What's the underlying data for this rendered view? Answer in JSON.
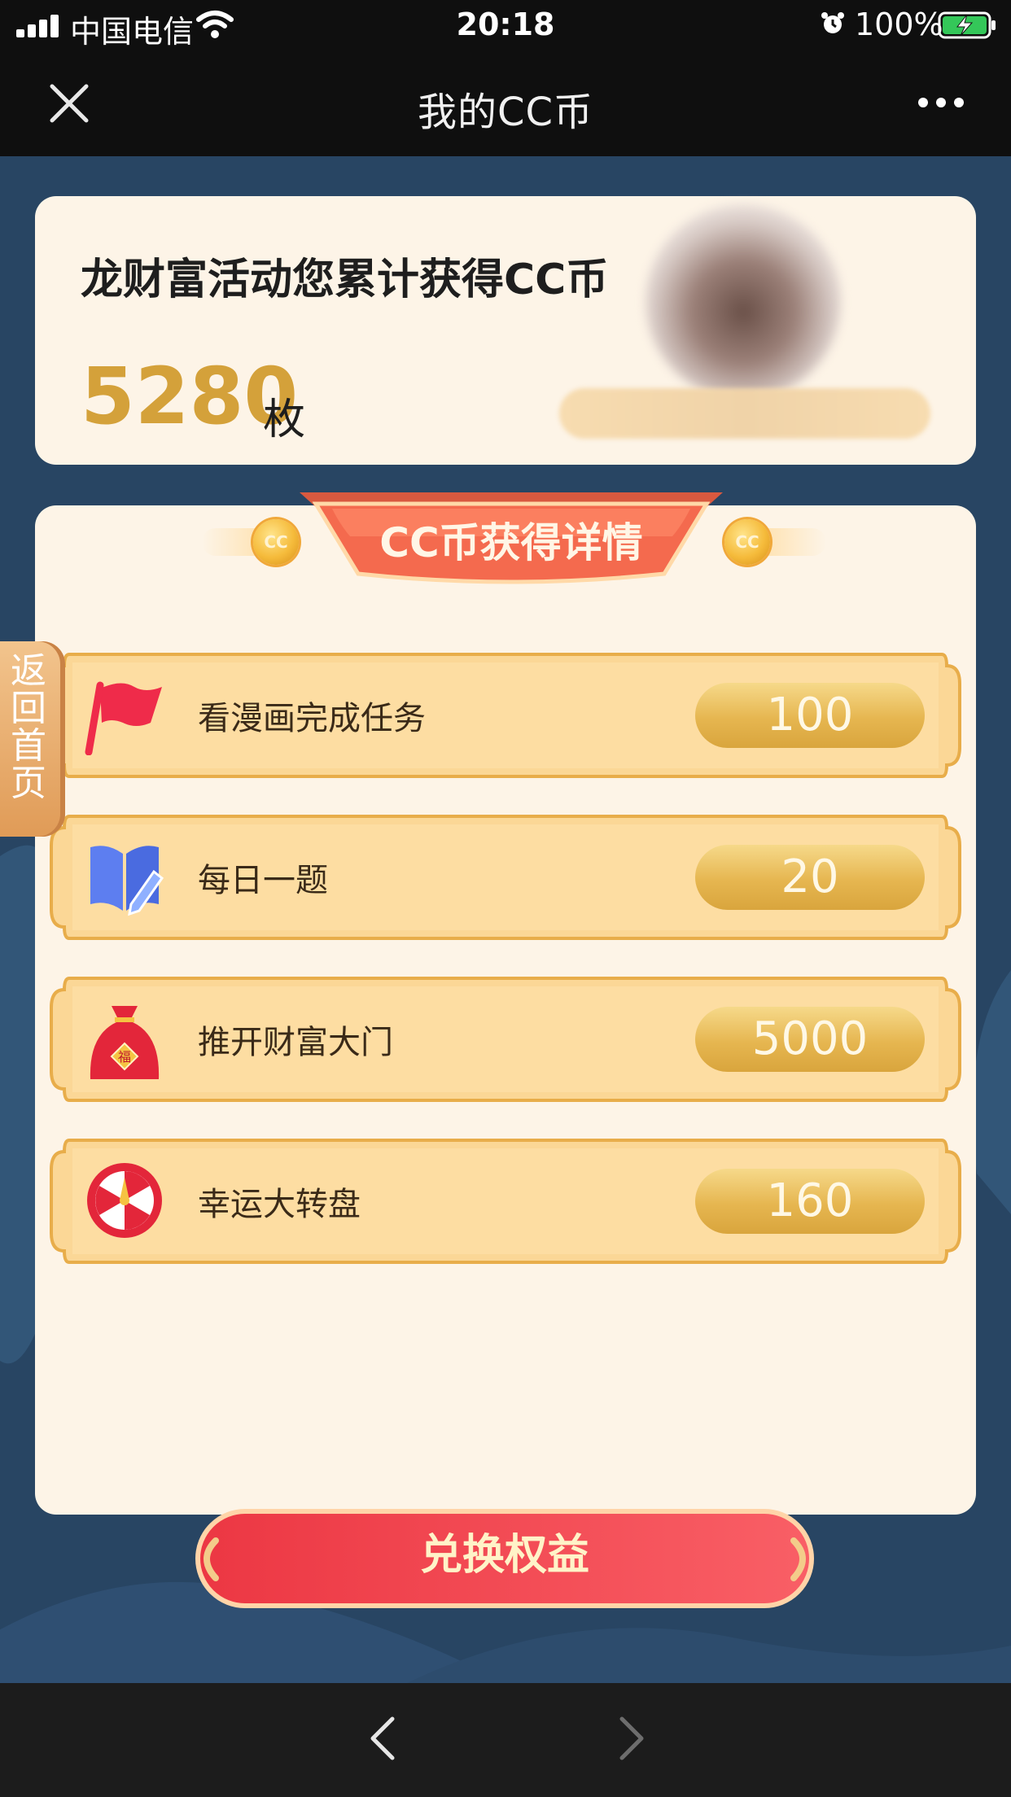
{
  "status_bar": {
    "carrier": "中国电信",
    "time": "20:18",
    "battery": "100%"
  },
  "nav": {
    "title": "我的CC币"
  },
  "summary": {
    "label": "龙财富活动您累计获得CC币",
    "amount": "5280",
    "unit": "枚"
  },
  "details": {
    "title": "CC币获得详情",
    "coin_label": "CC",
    "tasks": [
      {
        "label": "看漫画完成任务",
        "value": "100",
        "icon": "red-flag-icon"
      },
      {
        "label": "每日一题",
        "value": "20",
        "icon": "book-pen-icon"
      },
      {
        "label": "推开财富大门",
        "value": "5000",
        "icon": "fortune-bag-icon"
      },
      {
        "label": "幸运大转盘",
        "value": "160",
        "icon": "wheel-icon"
      }
    ],
    "redeem_label": "兑换权益"
  },
  "side_tab": {
    "label": "返回首页"
  },
  "colors": {
    "accent_gold": "#d4a13a",
    "page_bg": "#284563",
    "card_bg": "#fdf4e7",
    "ribbon": "#f46a4e",
    "button_red": "#ee4450"
  }
}
